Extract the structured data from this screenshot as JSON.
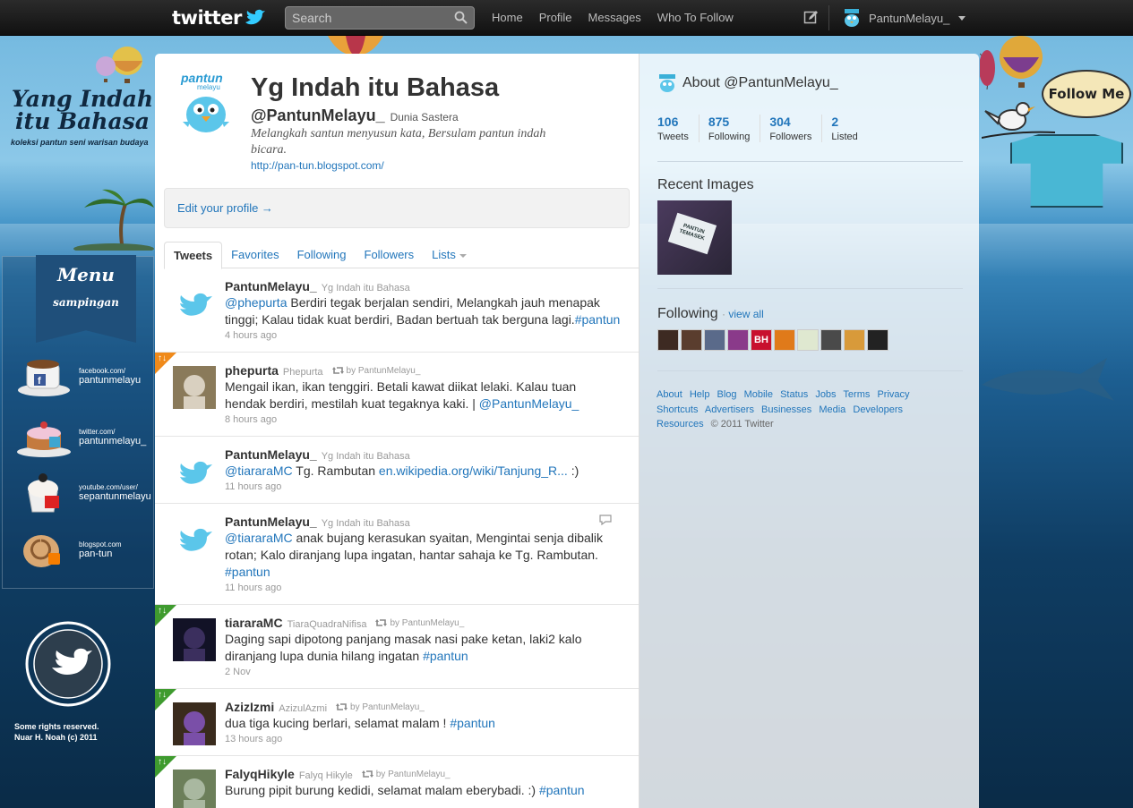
{
  "topbar": {
    "logo_text": "twitter",
    "search_placeholder": "Search",
    "nav": [
      "Home",
      "Profile",
      "Messages",
      "Who To Follow"
    ],
    "account_name": "PantunMelayu_"
  },
  "background": {
    "brand_title_line1": "Yang Indah",
    "brand_title_line2": "itu Bahasa",
    "brand_subtitle": "koleksi pantun seni warisan budaya",
    "menu_title": "Menu",
    "menu_subtitle": "sampingan",
    "socials": [
      {
        "site": "facebook.com/",
        "name": "pantunmelayu"
      },
      {
        "site": "twitter.com/",
        "name": "pantunmelayu_"
      },
      {
        "site": "youtube.com/user/",
        "name": "sepantunmelayu"
      },
      {
        "site": "blogspot.com",
        "name": "pan-tun"
      }
    ],
    "rights_line1": "Some rights reserved.",
    "rights_line2": "Nuar H. Noah (c) 2011",
    "follow_me": "Follow Me"
  },
  "profile": {
    "avatar_text_top": "pantun",
    "avatar_text_sub": "melayu",
    "name": "Yg Indah itu Bahasa",
    "handle": "@PantunMelayu_",
    "location": "Dunia Sastera",
    "bio": "Melangkah santun menyusun kata, Bersulam pantun indah bicara.",
    "url": "http://pan-tun.blogspot.com/",
    "edit_profile": "Edit your profile →"
  },
  "tabs": [
    "Tweets",
    "Favorites",
    "Following",
    "Followers",
    "Lists"
  ],
  "tweets": [
    {
      "user": "PantunMelayu_",
      "fullname": "Yg Indah itu Bahasa",
      "retweet_by": "",
      "parts": [
        {
          "t": "@phepurta",
          "link": true
        },
        {
          "t": " Berdiri tegak berjalan sendiri, Melangkah jauh menapak tinggi; Kalau tidak kuat berdiri, Badan bertuah tak berguna lagi.",
          "link": false
        },
        {
          "t": "#pantun",
          "link": true
        }
      ],
      "time": "4 hours ago",
      "avatar": "bird",
      "corner": "",
      "reply_icon": false
    },
    {
      "user": "phepurta",
      "fullname": "Phepurta",
      "retweet_by": "by PantunMelayu_",
      "parts": [
        {
          "t": "Mengail ikan, ikan tenggiri. Betali kawat diikat lelaki. Kalau tuan hendak berdiri, mestilah kuat tegaknya kaki. | ",
          "link": false
        },
        {
          "t": "@PantunMelayu_",
          "link": true
        }
      ],
      "time": "8 hours ago",
      "avatar": "photo1",
      "corner": "orange",
      "reply_icon": false
    },
    {
      "user": "PantunMelayu_",
      "fullname": "Yg Indah itu Bahasa",
      "retweet_by": "",
      "parts": [
        {
          "t": "@tiararaMC",
          "link": true
        },
        {
          "t": " Tg. Rambutan ",
          "link": false
        },
        {
          "t": "en.wikipedia.org/wiki/Tanjung_R...",
          "link": true
        },
        {
          "t": " :)",
          "link": false
        }
      ],
      "time": "11 hours ago",
      "avatar": "bird",
      "corner": "",
      "reply_icon": false
    },
    {
      "user": "PantunMelayu_",
      "fullname": "Yg Indah itu Bahasa",
      "retweet_by": "",
      "parts": [
        {
          "t": "@tiararaMC",
          "link": true
        },
        {
          "t": " anak bujang kerasukan syaitan, Mengintai senja dibalik rotan; Kalo diranjang lupa ingatan, hantar sahaja ke Tg. Rambutan. ",
          "link": false
        },
        {
          "t": "#pantun",
          "link": true
        }
      ],
      "time": "11 hours ago",
      "avatar": "bird",
      "corner": "",
      "reply_icon": true
    },
    {
      "user": "tiararaMC",
      "fullname": "TiaraQuadraNifisa",
      "retweet_by": "by PantunMelayu_",
      "parts": [
        {
          "t": "Daging sapi dipotong panjang masak nasi pake ketan, laki2 kalo diranjang lupa dunia hilang ingatan ",
          "link": false
        },
        {
          "t": "#pantun",
          "link": true
        }
      ],
      "time": "2 Nov",
      "avatar": "photo2",
      "corner": "green",
      "reply_icon": false
    },
    {
      "user": "AzizIzmi",
      "fullname": "AzizulAzmi",
      "retweet_by": "by PantunMelayu_",
      "parts": [
        {
          "t": "dua tiga kucing berlari, selamat malam ! ",
          "link": false
        },
        {
          "t": "#pantun",
          "link": true
        }
      ],
      "time": "13 hours ago",
      "avatar": "photo3",
      "corner": "green",
      "reply_icon": false
    },
    {
      "user": "FalyqHikyle",
      "fullname": "Falyq Hikyle",
      "retweet_by": "by PantunMelayu_",
      "parts": [
        {
          "t": "Burung pipit burung kedidi, selamat malam eberybadi. :) ",
          "link": false
        },
        {
          "t": "#pantun",
          "link": true
        }
      ],
      "time": "",
      "avatar": "photo4",
      "corner": "green",
      "reply_icon": false
    }
  ],
  "dashboard": {
    "about": "About @PantunMelayu_",
    "stats": [
      {
        "num": "106",
        "label": "Tweets"
      },
      {
        "num": "875",
        "label": "Following"
      },
      {
        "num": "304",
        "label": "Followers"
      },
      {
        "num": "2",
        "label": "Listed"
      }
    ],
    "recent_images": "Recent Images",
    "recent_image_caption_1": "PANTUN",
    "recent_image_caption_2": "TEMASEK",
    "following": "Following",
    "view_all": "view all",
    "following_badges": [
      "",
      "",
      "",
      "",
      "BH",
      "",
      "",
      "",
      "",
      ""
    ],
    "footer_links": [
      "About",
      "Help",
      "Blog",
      "Mobile",
      "Status",
      "Jobs",
      "Terms",
      "Privacy",
      "Shortcuts",
      "Advertisers",
      "Businesses",
      "Media",
      "Developers",
      "Resources"
    ],
    "copyright": "© 2011 Twitter"
  },
  "colors": {
    "link": "#2276bb",
    "topbar": "#1a1a1a",
    "retweet_green": "#3f9b2f",
    "retweet_orange": "#f08a1a"
  }
}
